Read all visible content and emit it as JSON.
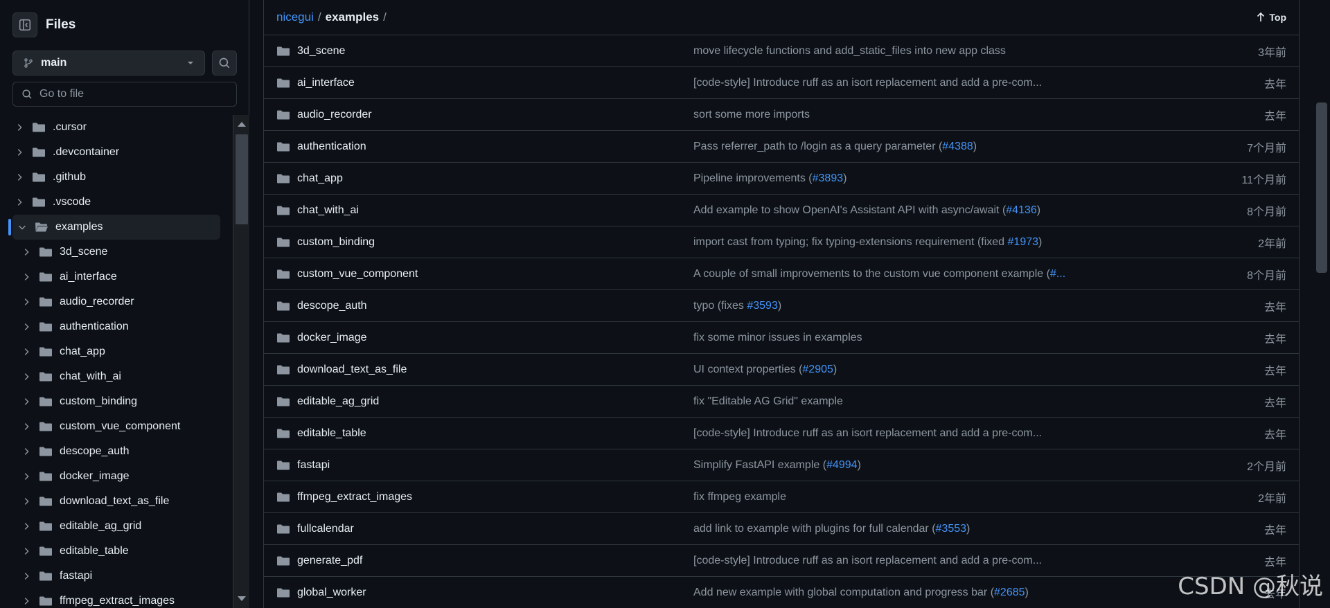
{
  "sidebar": {
    "title": "Files",
    "branch": "main",
    "goto_placeholder": "Go to file",
    "tree": [
      {
        "name": ".cursor",
        "depth": 0,
        "open": false
      },
      {
        "name": ".devcontainer",
        "depth": 0,
        "open": false
      },
      {
        "name": ".github",
        "depth": 0,
        "open": false
      },
      {
        "name": ".vscode",
        "depth": 0,
        "open": false
      },
      {
        "name": "examples",
        "depth": 0,
        "open": true,
        "selected": true
      },
      {
        "name": "3d_scene",
        "depth": 1,
        "open": false
      },
      {
        "name": "ai_interface",
        "depth": 1,
        "open": false
      },
      {
        "name": "audio_recorder",
        "depth": 1,
        "open": false
      },
      {
        "name": "authentication",
        "depth": 1,
        "open": false
      },
      {
        "name": "chat_app",
        "depth": 1,
        "open": false
      },
      {
        "name": "chat_with_ai",
        "depth": 1,
        "open": false
      },
      {
        "name": "custom_binding",
        "depth": 1,
        "open": false
      },
      {
        "name": "custom_vue_component",
        "depth": 1,
        "open": false
      },
      {
        "name": "descope_auth",
        "depth": 1,
        "open": false
      },
      {
        "name": "docker_image",
        "depth": 1,
        "open": false
      },
      {
        "name": "download_text_as_file",
        "depth": 1,
        "open": false
      },
      {
        "name": "editable_ag_grid",
        "depth": 1,
        "open": false
      },
      {
        "name": "editable_table",
        "depth": 1,
        "open": false
      },
      {
        "name": "fastapi",
        "depth": 1,
        "open": false
      },
      {
        "name": "ffmpeg_extract_images",
        "depth": 1,
        "open": false
      }
    ]
  },
  "breadcrumb": {
    "repo": "nicegui",
    "sep": "/",
    "folder": "examples",
    "trail": "/"
  },
  "top_label": "Top",
  "rows": [
    {
      "name": "3d_scene",
      "msg": "move lifecycle functions and add_static_files into new app class",
      "issue": "",
      "msg_end": "",
      "age": "3年前"
    },
    {
      "name": "ai_interface",
      "msg": "[code-style] Introduce ruff as an isort replacement and add a pre-com...",
      "issue": "",
      "msg_end": "",
      "age": "去年"
    },
    {
      "name": "audio_recorder",
      "msg": "sort some more imports",
      "issue": "",
      "msg_end": "",
      "age": "去年"
    },
    {
      "name": "authentication",
      "msg": "Pass referrer_path to /login as a query parameter (",
      "issue": "#4388",
      "msg_end": ")",
      "age": "7个月前"
    },
    {
      "name": "chat_app",
      "msg": "Pipeline improvements (",
      "issue": "#3893",
      "msg_end": ")",
      "age": "11个月前"
    },
    {
      "name": "chat_with_ai",
      "msg": "Add example to show OpenAI's Assistant API with async/await (",
      "issue": "#4136",
      "msg_end": ")",
      "age": "8个月前"
    },
    {
      "name": "custom_binding",
      "msg": "import cast from typing; fix typing-extensions requirement (fixed ",
      "issue": "#1973",
      "msg_end": ")",
      "age": "2年前"
    },
    {
      "name": "custom_vue_component",
      "msg": "A couple of small improvements to the custom vue component example (",
      "issue": "#...",
      "msg_end": "",
      "age": "8个月前"
    },
    {
      "name": "descope_auth",
      "msg": "typo (fixes ",
      "issue": "#3593",
      "msg_end": ")",
      "age": "去年"
    },
    {
      "name": "docker_image",
      "msg": "fix some minor issues in examples",
      "issue": "",
      "msg_end": "",
      "age": "去年"
    },
    {
      "name": "download_text_as_file",
      "msg": "UI context properties (",
      "issue": "#2905",
      "msg_end": ")",
      "age": "去年"
    },
    {
      "name": "editable_ag_grid",
      "msg": "fix \"Editable AG Grid\" example",
      "issue": "",
      "msg_end": "",
      "age": "去年"
    },
    {
      "name": "editable_table",
      "msg": "[code-style] Introduce ruff as an isort replacement and add a pre-com...",
      "issue": "",
      "msg_end": "",
      "age": "去年"
    },
    {
      "name": "fastapi",
      "msg": "Simplify FastAPI example (",
      "issue": "#4994",
      "msg_end": ")",
      "age": "2个月前"
    },
    {
      "name": "ffmpeg_extract_images",
      "msg": "fix ffmpeg example",
      "issue": "",
      "msg_end": "",
      "age": "2年前"
    },
    {
      "name": "fullcalendar",
      "msg": "add link to example with plugins for full calendar (",
      "issue": "#3553",
      "msg_end": ")",
      "age": "去年"
    },
    {
      "name": "generate_pdf",
      "msg": "[code-style] Introduce ruff as an isort replacement and add a pre-com...",
      "issue": "",
      "msg_end": "",
      "age": "去年"
    },
    {
      "name": "global_worker",
      "msg": "Add new example with global computation and progress bar (",
      "issue": "#2685",
      "msg_end": ")",
      "age": "去年"
    }
  ],
  "watermark": "CSDN @秋说",
  "colors": {
    "bg": "#0d1117",
    "border": "#30363d",
    "link": "#4493f8",
    "muted": "#8d96a0",
    "folder": "#8d96a0"
  }
}
